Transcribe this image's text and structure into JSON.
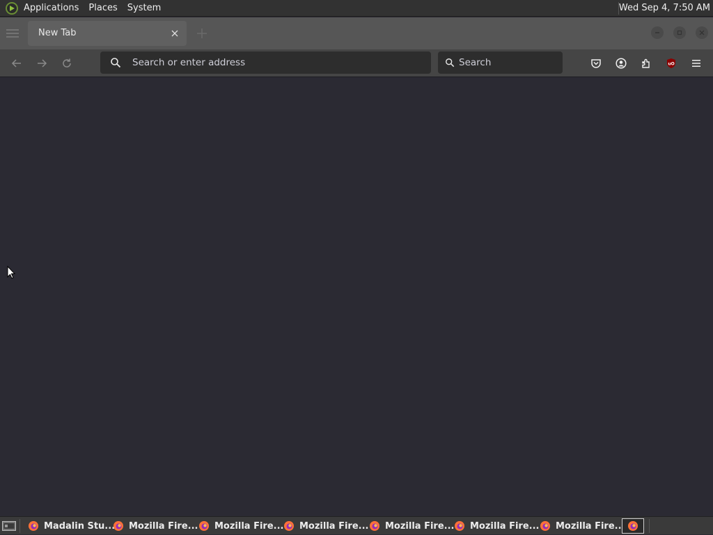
{
  "top_panel": {
    "menus": [
      "Applications",
      "Places",
      "System"
    ],
    "clock": "Wed Sep  4,  7:50 AM",
    "logo_icon": "os-menu-logo-icon"
  },
  "browser": {
    "tab": {
      "title": "New Tab",
      "close_icon": "close-icon"
    },
    "toolbar": {
      "back_icon": "arrow-left-icon",
      "forward_icon": "arrow-right-icon",
      "reload_icon": "reload-icon",
      "url_placeholder": "Search or enter address",
      "search_placeholder": "Search",
      "right_icons": [
        "pocket-icon",
        "account-icon",
        "extensions-icon",
        "ublock-origin-icon",
        "hamburger-menu-icon"
      ]
    },
    "colors": {
      "content_bg": "#2b2a33",
      "toolbar_bg": "#454545",
      "tabstrip_bg": "#565656",
      "ublock_red": "#8b0000"
    }
  },
  "taskbar": {
    "items": [
      {
        "label": "Madalin Stu..."
      },
      {
        "label": "Mozilla Fire..."
      },
      {
        "label": "Mozilla Fire..."
      },
      {
        "label": "Mozilla Fire..."
      },
      {
        "label": "Mozilla Fire..."
      },
      {
        "label": "Mozilla Fire..."
      },
      {
        "label": "Mozilla Fire..."
      }
    ],
    "app_icon": "firefox-icon",
    "show_desktop_icon": "show-desktop-icon"
  }
}
